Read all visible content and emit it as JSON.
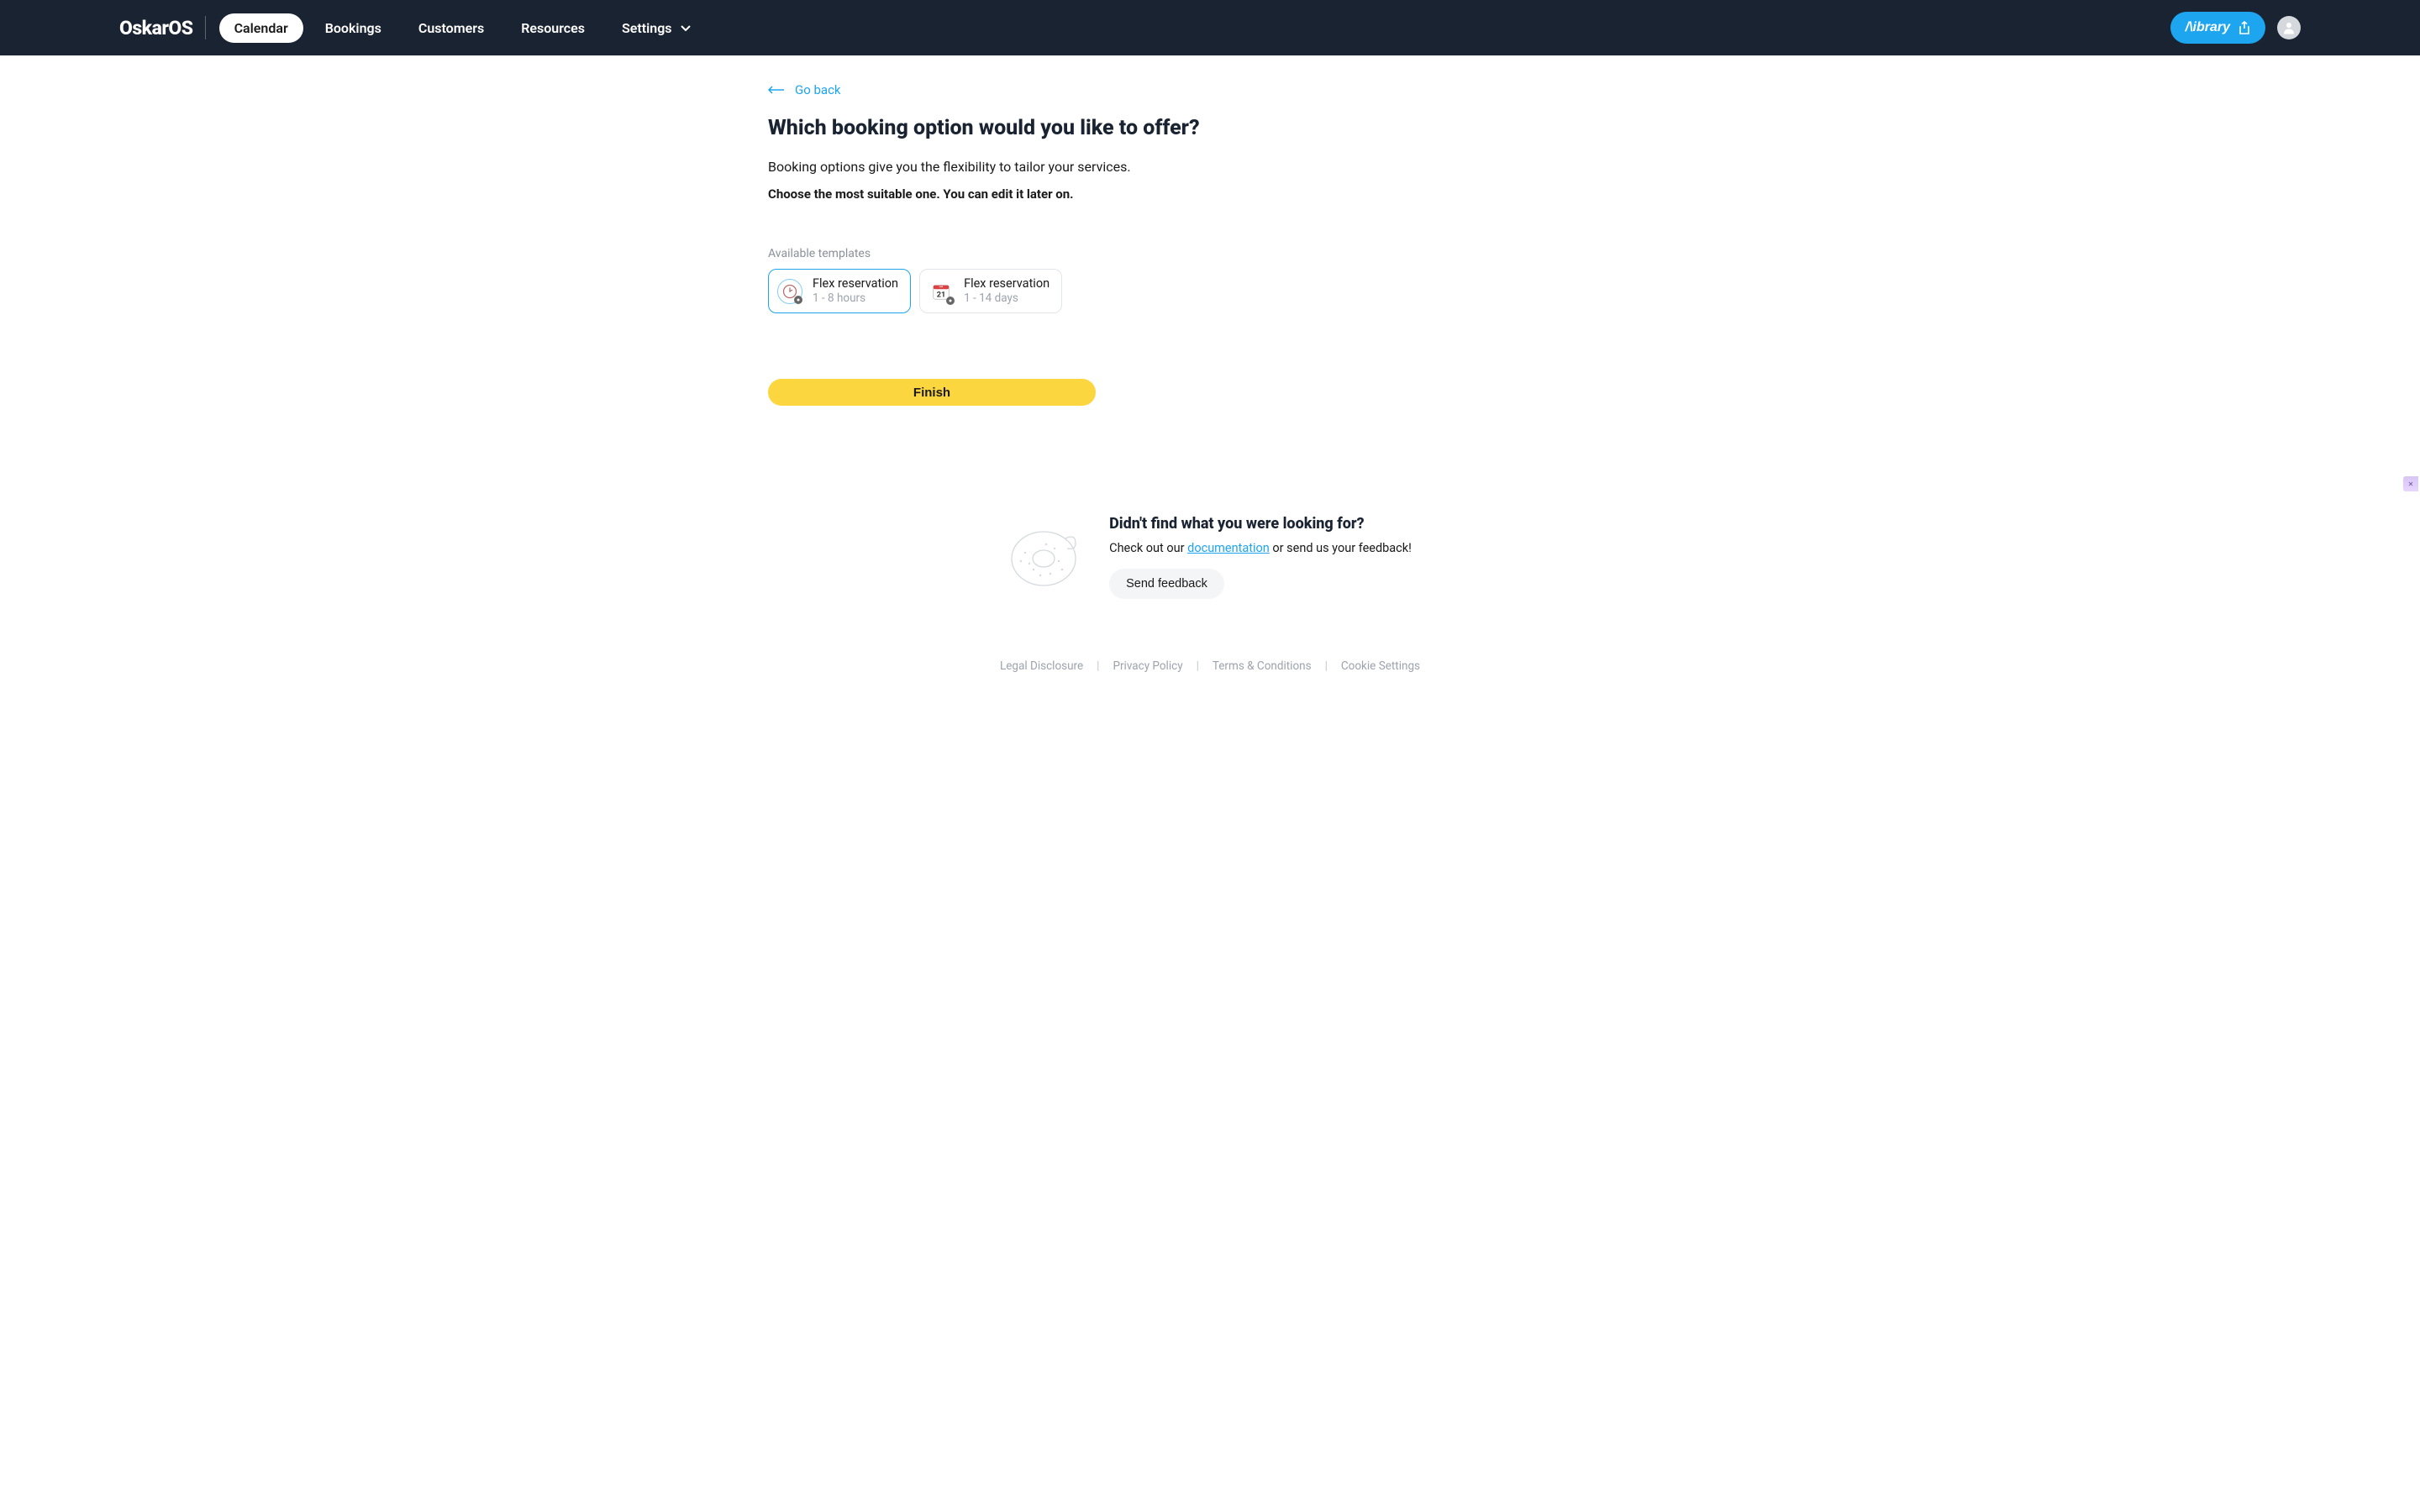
{
  "header": {
    "logo": "OskarOS",
    "nav": [
      {
        "label": "Calendar",
        "active": true
      },
      {
        "label": "Bookings",
        "active": false
      },
      {
        "label": "Customers",
        "active": false
      },
      {
        "label": "Resources",
        "active": false
      },
      {
        "label": "Settings",
        "active": false,
        "has_chevron": true
      }
    ],
    "library_label": "/\\ibrary"
  },
  "go_back": "Go back",
  "page_title": "Which booking option would you like to offer?",
  "page_subtitle": "Booking options give you the flexibility to tailor your services.",
  "choose_hint": "Choose the most suitable one. You can edit it later on.",
  "section_label": "Available templates",
  "templates": [
    {
      "name": "Flex reservation",
      "desc": "1 - 8 hours",
      "icon": "clock",
      "selected": true
    },
    {
      "name": "Flex reservation",
      "desc": "1 - 14 days",
      "icon": "calendar",
      "selected": false
    }
  ],
  "finish_label": "Finish",
  "help": {
    "title": "Didn't find what you were looking for?",
    "text_prefix": "Check out our ",
    "link_text": "documentation",
    "text_suffix": " or send us your feedback!",
    "feedback_label": "Send feedback"
  },
  "footer": {
    "links": [
      "Legal Disclosure",
      "Privacy Policy",
      "Terms & Conditions",
      "Cookie Settings"
    ]
  }
}
